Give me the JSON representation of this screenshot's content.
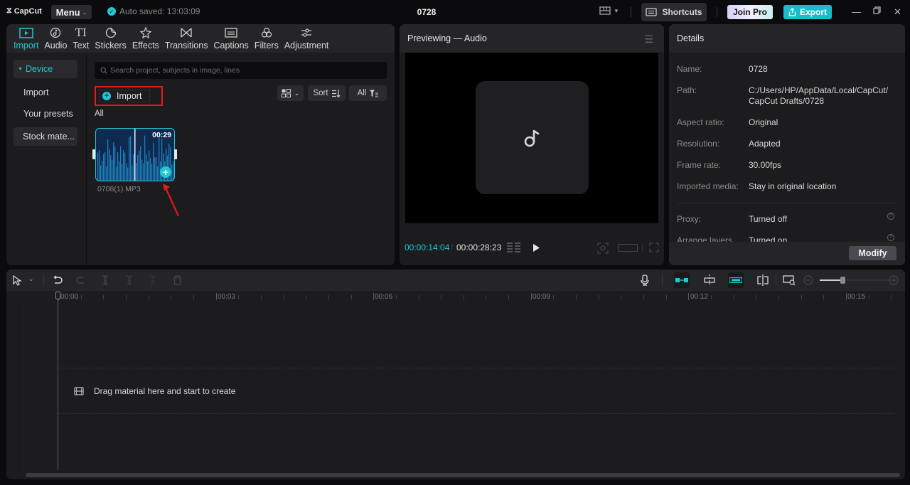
{
  "app": {
    "logo_text": "CapCut",
    "menu_label": "Menu",
    "autosave_text": "Auto saved: 13:03:09",
    "project_title": "0728",
    "shortcuts_label": "Shortcuts",
    "join_pro_label": "Join Pro",
    "export_label": "Export",
    "accent_color": "#1fc8d4"
  },
  "tool_tabs": [
    {
      "label": "Import",
      "icon": "import-icon",
      "active": true
    },
    {
      "label": "Audio",
      "icon": "audio-icon"
    },
    {
      "label": "Text",
      "icon": "text-icon"
    },
    {
      "label": "Stickers",
      "icon": "stickers-icon"
    },
    {
      "label": "Effects",
      "icon": "effects-icon"
    },
    {
      "label": "Transitions",
      "icon": "transitions-icon"
    },
    {
      "label": "Captions",
      "icon": "captions-icon"
    },
    {
      "label": "Filters",
      "icon": "filters-icon"
    },
    {
      "label": "Adjustment",
      "icon": "adjustment-icon"
    }
  ],
  "media": {
    "sidebar": [
      {
        "label": "Device",
        "active": true
      },
      {
        "label": "Import"
      },
      {
        "label": "Your presets"
      },
      {
        "label": "Stock mate..."
      }
    ],
    "search_placeholder": "Search project, subjects in image, lines",
    "import_label": "Import",
    "sort_label": "Sort",
    "filter_label": "All",
    "section_label": "All",
    "items": [
      {
        "name": "0708(1).MP3",
        "duration": "00:29"
      }
    ]
  },
  "preview": {
    "title": "Previewing — Audio",
    "current_time": "00:00:14:04",
    "separator": "/",
    "total_time": "00:00:28:23"
  },
  "details": {
    "title": "Details",
    "rows": [
      {
        "label": "Name:",
        "value": "0728"
      },
      {
        "label": "Path:",
        "value": "C:/Users/HP/AppData/Local/CapCut/ CapCut Drafts/0728"
      },
      {
        "label": "Aspect ratio:",
        "value": "Original"
      },
      {
        "label": "Resolution:",
        "value": "Adapted"
      },
      {
        "label": "Frame rate:",
        "value": "30.00fps"
      },
      {
        "label": "Imported media:",
        "value": "Stay in original location"
      },
      {
        "label": "Proxy:",
        "value": "Turned off"
      },
      {
        "label": "Arrange layers",
        "value": "Turned on"
      }
    ],
    "modify_label": "Modify"
  },
  "timeline": {
    "ruler_labels": [
      "00:00",
      "00:03",
      "00:06",
      "00:09",
      "00:12",
      "00:15"
    ],
    "empty_hint": "Drag material here and start to create",
    "zoom_level": 0.3
  }
}
